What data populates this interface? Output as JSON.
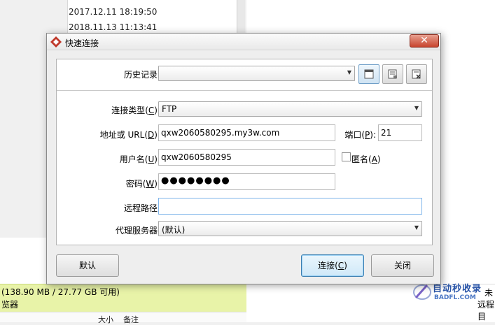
{
  "background": {
    "list_rows": [
      "2017.12.11 18:19:50",
      "2018.11.13 11:13:41"
    ],
    "status_line": "(138.90 MB / 27.77 GB 可用)",
    "status_sub": "览器",
    "col_size": "大小",
    "col_note": "备注",
    "right_text_1": "未",
    "right_text_2": "远程目"
  },
  "watermark": {
    "cn": "自动秒收录",
    "en": "BADFL.COM"
  },
  "dialog": {
    "title": "快速连接",
    "close_glyph": "✕",
    "history_label": "历史记录:",
    "history_value": "",
    "conn_type_label": "连接类型(",
    "conn_type_key": "C",
    "conn_type_tail": "):",
    "conn_type_value": "FTP",
    "url_label": "地址或 URL(",
    "url_key": "D",
    "url_tail": "):",
    "url_value": "qxw2060580295.my3w.com",
    "port_label": "端口(",
    "port_key": "P",
    "port_tail": "):",
    "port_value": "21",
    "user_label": "用户名(",
    "user_key": "U",
    "user_tail": "):",
    "user_value": "qxw2060580295",
    "anon_label": "匿名(",
    "anon_key": "A",
    "anon_tail": ")",
    "pass_label": "密码(",
    "pass_key": "W",
    "pass_tail": "):",
    "pass_value": "●●●●●●●●",
    "remote_path_label": "远程路径:",
    "remote_path_value": "",
    "proxy_label": "代理服务器:",
    "proxy_value": "(默认)",
    "default_button": "默认",
    "connect_label": "连接(",
    "connect_key": "C",
    "connect_tail": ")",
    "close_button": "关闭"
  }
}
